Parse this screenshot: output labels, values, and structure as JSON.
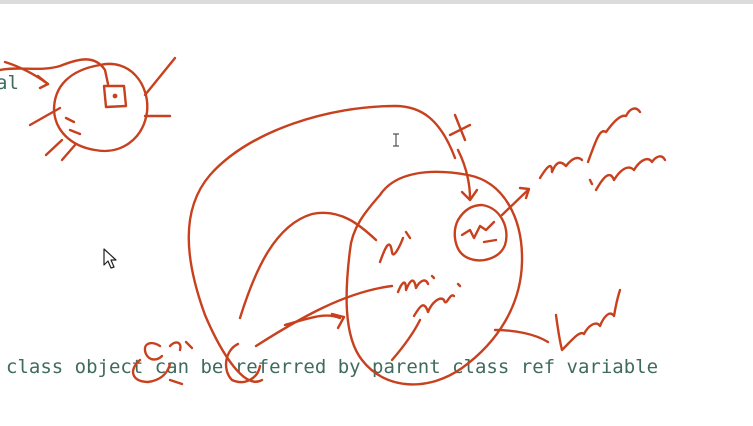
{
  "code": {
    "fragment": "al",
    "line": "class object can be referred by parent class ref variable"
  },
  "colors": {
    "background": "#ffffff",
    "code_text": "#3f6b5f",
    "ink": "#c8411e"
  },
  "icons": {
    "pointer": "mouse-pointer-icon",
    "ibeam": "text-cursor-icon"
  }
}
